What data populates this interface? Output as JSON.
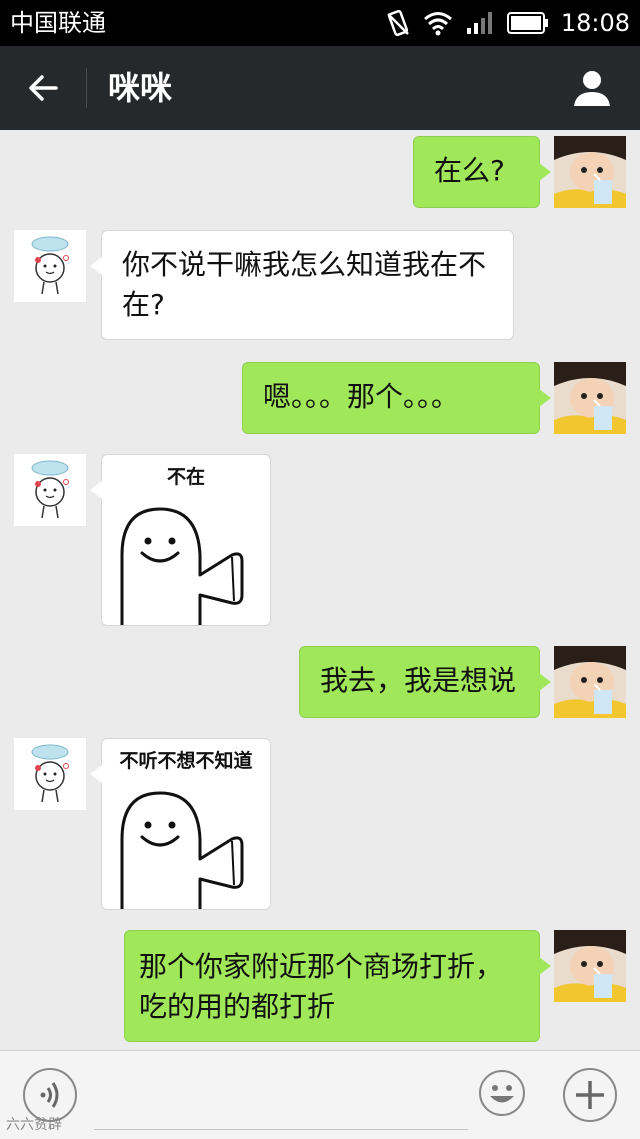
{
  "status_bar": {
    "carrier": "中国联通",
    "time": "18:08"
  },
  "header": {
    "title": "咪咪"
  },
  "messages": [
    {
      "side": "right",
      "type": "text",
      "text": "在么?"
    },
    {
      "side": "left",
      "type": "text",
      "lines": [
        "你不说干嘛我怎么知道我在不",
        "在?"
      ]
    },
    {
      "side": "right",
      "type": "text",
      "text": "嗯。。。那个。。。"
    },
    {
      "side": "left",
      "type": "sticker",
      "caption": "不在"
    },
    {
      "side": "right",
      "type": "text",
      "text": "我去，我是想说"
    },
    {
      "side": "left",
      "type": "sticker",
      "caption": "不听不想不知道"
    },
    {
      "side": "right",
      "type": "text",
      "lines": [
        "那个你家附近那个商场打折，",
        "吃的用的都打折"
      ]
    }
  ],
  "input": {
    "value": ""
  },
  "watermark": "六六贫辟",
  "colors": {
    "sent_bubble": "#a0e75a",
    "received_bubble": "#ffffff",
    "title_bar": "#26292c",
    "chat_bg": "#ebebeb"
  },
  "icons": [
    "back-arrow-icon",
    "profile-icon",
    "voice-icon",
    "emoji-icon",
    "plus-icon"
  ]
}
